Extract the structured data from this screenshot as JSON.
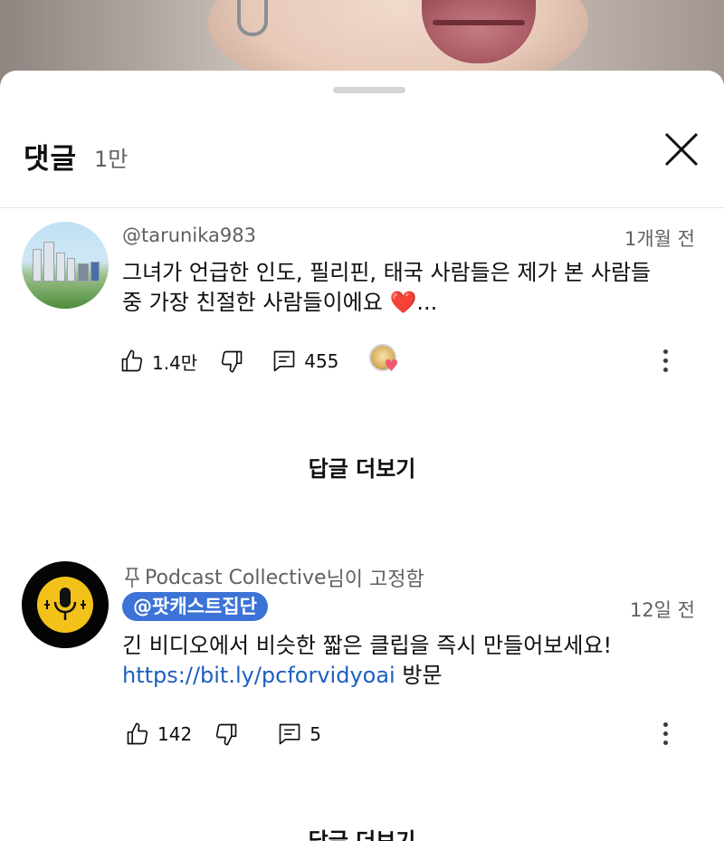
{
  "sheet": {
    "title": "댓글",
    "count": "1만"
  },
  "comments": [
    {
      "handle": "@tarunika983",
      "time": "1개월 전",
      "text_line1": "그녀가 언급한 인도, 필리핀, 태국 사람들은 제가 본 사람들",
      "text_line2": "중 가장 친절한 사람들이에요",
      "emoji": "❤️",
      "ellipsis": "...",
      "likes": "1.4만",
      "replies": "455",
      "view_replies_label": "답글 더보기"
    },
    {
      "pinned_prefix": "Podcast Collective",
      "pinned_suffix": "님이 고정함",
      "handle": "@팟캐스트집단",
      "time": "12일 전",
      "text_line1": "긴 비디오에서 비슷한 짧은 클립을 즉시 만들어보세요!",
      "link": "https://bit.ly/pcforvidyoai",
      "link_suffix": " 방문",
      "likes": "142",
      "replies": "5",
      "view_replies_label": "답글 더보기"
    }
  ],
  "colors": {
    "accent_link": "#1d5fc2",
    "chip_bg": "#3b73d6",
    "secondary_text": "#606060",
    "heart": "#e0192f"
  }
}
